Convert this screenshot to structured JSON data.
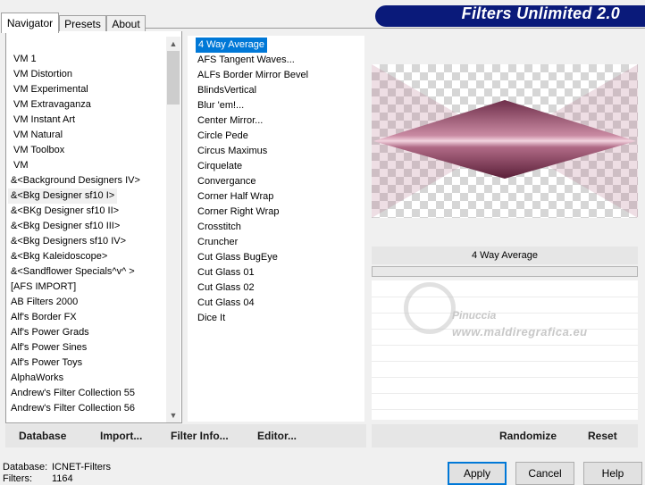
{
  "banner": {
    "title": "Filters Unlimited 2.0"
  },
  "tabs": [
    {
      "label": "Navigator",
      "active": true
    },
    {
      "label": "Presets",
      "active": false
    },
    {
      "label": "About",
      "active": false
    }
  ],
  "categories": [
    "VM 1",
    "VM Distortion",
    "VM Experimental",
    "VM Extravaganza",
    "VM Instant Art",
    "VM Natural",
    "VM Toolbox",
    "VM",
    "&<Background Designers IV>",
    "&<Bkg Designer sf10 I>",
    "&<BKg Designer sf10 II>",
    "&<Bkg Designer sf10 III>",
    "&<Bkg Designers sf10 IV>",
    "&<Bkg Kaleidoscope>",
    "&<Sandflower Specials^v^ >",
    "[AFS IMPORT]",
    "AB Filters 2000",
    "Alf's Border FX",
    "Alf's Power Grads",
    "Alf's Power Sines",
    "Alf's Power Toys",
    "AlphaWorks",
    "Andrew's Filter Collection 55",
    "Andrew's Filter Collection 56"
  ],
  "selected_category_index": 9,
  "filters": [
    "4 Way Average",
    "AFS Tangent Waves...",
    "ALFs Border Mirror Bevel",
    "BlindsVertical",
    "Blur 'em!...",
    "Center Mirror...",
    "Circle Pede",
    "Circus Maximus",
    "Cirquelate",
    "Convergance",
    "Corner Half Wrap",
    "Corner Right Wrap",
    "Crosstitch",
    "Cruncher",
    "Cut Glass  BugEye",
    "Cut Glass 01",
    "Cut Glass 02",
    "Cut Glass 04",
    "Dice It"
  ],
  "selected_filter_index": 0,
  "preview": {
    "filter_name": "4 Way Average",
    "shape_color": "#b06a86"
  },
  "watermark": {
    "name": "Pinuccia",
    "url": "www.maldiregrafica.eu"
  },
  "left_buttons": {
    "database": "Database",
    "import": "Import...",
    "filter_info": "Filter Info...",
    "editor": "Editor..."
  },
  "right_buttons": {
    "randomize": "Randomize",
    "reset": "Reset"
  },
  "status": {
    "database_label": "Database:",
    "database_value": "ICNET-Filters",
    "filters_label": "Filters:",
    "filters_value": "1164"
  },
  "dialog_buttons": {
    "apply": "Apply",
    "cancel": "Cancel",
    "help": "Help"
  },
  "colors": {
    "banner": "#0a1a7a",
    "selection": "#0078d7",
    "accent": "#0078d7"
  }
}
